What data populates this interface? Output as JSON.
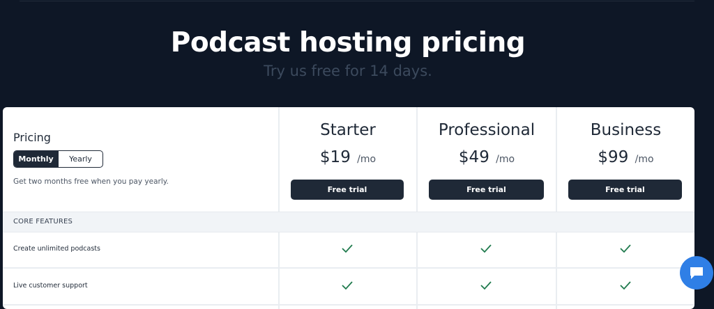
{
  "hero": {
    "title": "Podcast hosting pricing",
    "subtitle": "Try us free for 14 days."
  },
  "pricing_panel": {
    "label": "Pricing",
    "toggle": {
      "monthly": "Monthly",
      "yearly": "Yearly",
      "selected": "Monthly"
    },
    "note": "Get two months free when you pay yearly."
  },
  "plans": [
    {
      "name": "Starter",
      "price": "$19",
      "period": "/mo",
      "cta": "Free trial"
    },
    {
      "name": "Professional",
      "price": "$49",
      "period": "/mo",
      "cta": "Free trial"
    },
    {
      "name": "Business",
      "price": "$99",
      "period": "/mo",
      "cta": "Free trial"
    }
  ],
  "sections": [
    {
      "title": "CORE FEATURES",
      "features": [
        {
          "label": "Create unlimited podcasts",
          "included": [
            true,
            true,
            true
          ]
        },
        {
          "label": "Live customer support",
          "included": [
            true,
            true,
            true
          ]
        }
      ]
    }
  ],
  "colors": {
    "background": "#0e1726",
    "button": "#1f2937",
    "check": "#1f7a4d",
    "chat": "#2f7fe6"
  },
  "icons": {
    "included": "check-icon",
    "chat": "chat-bubble-icon"
  }
}
